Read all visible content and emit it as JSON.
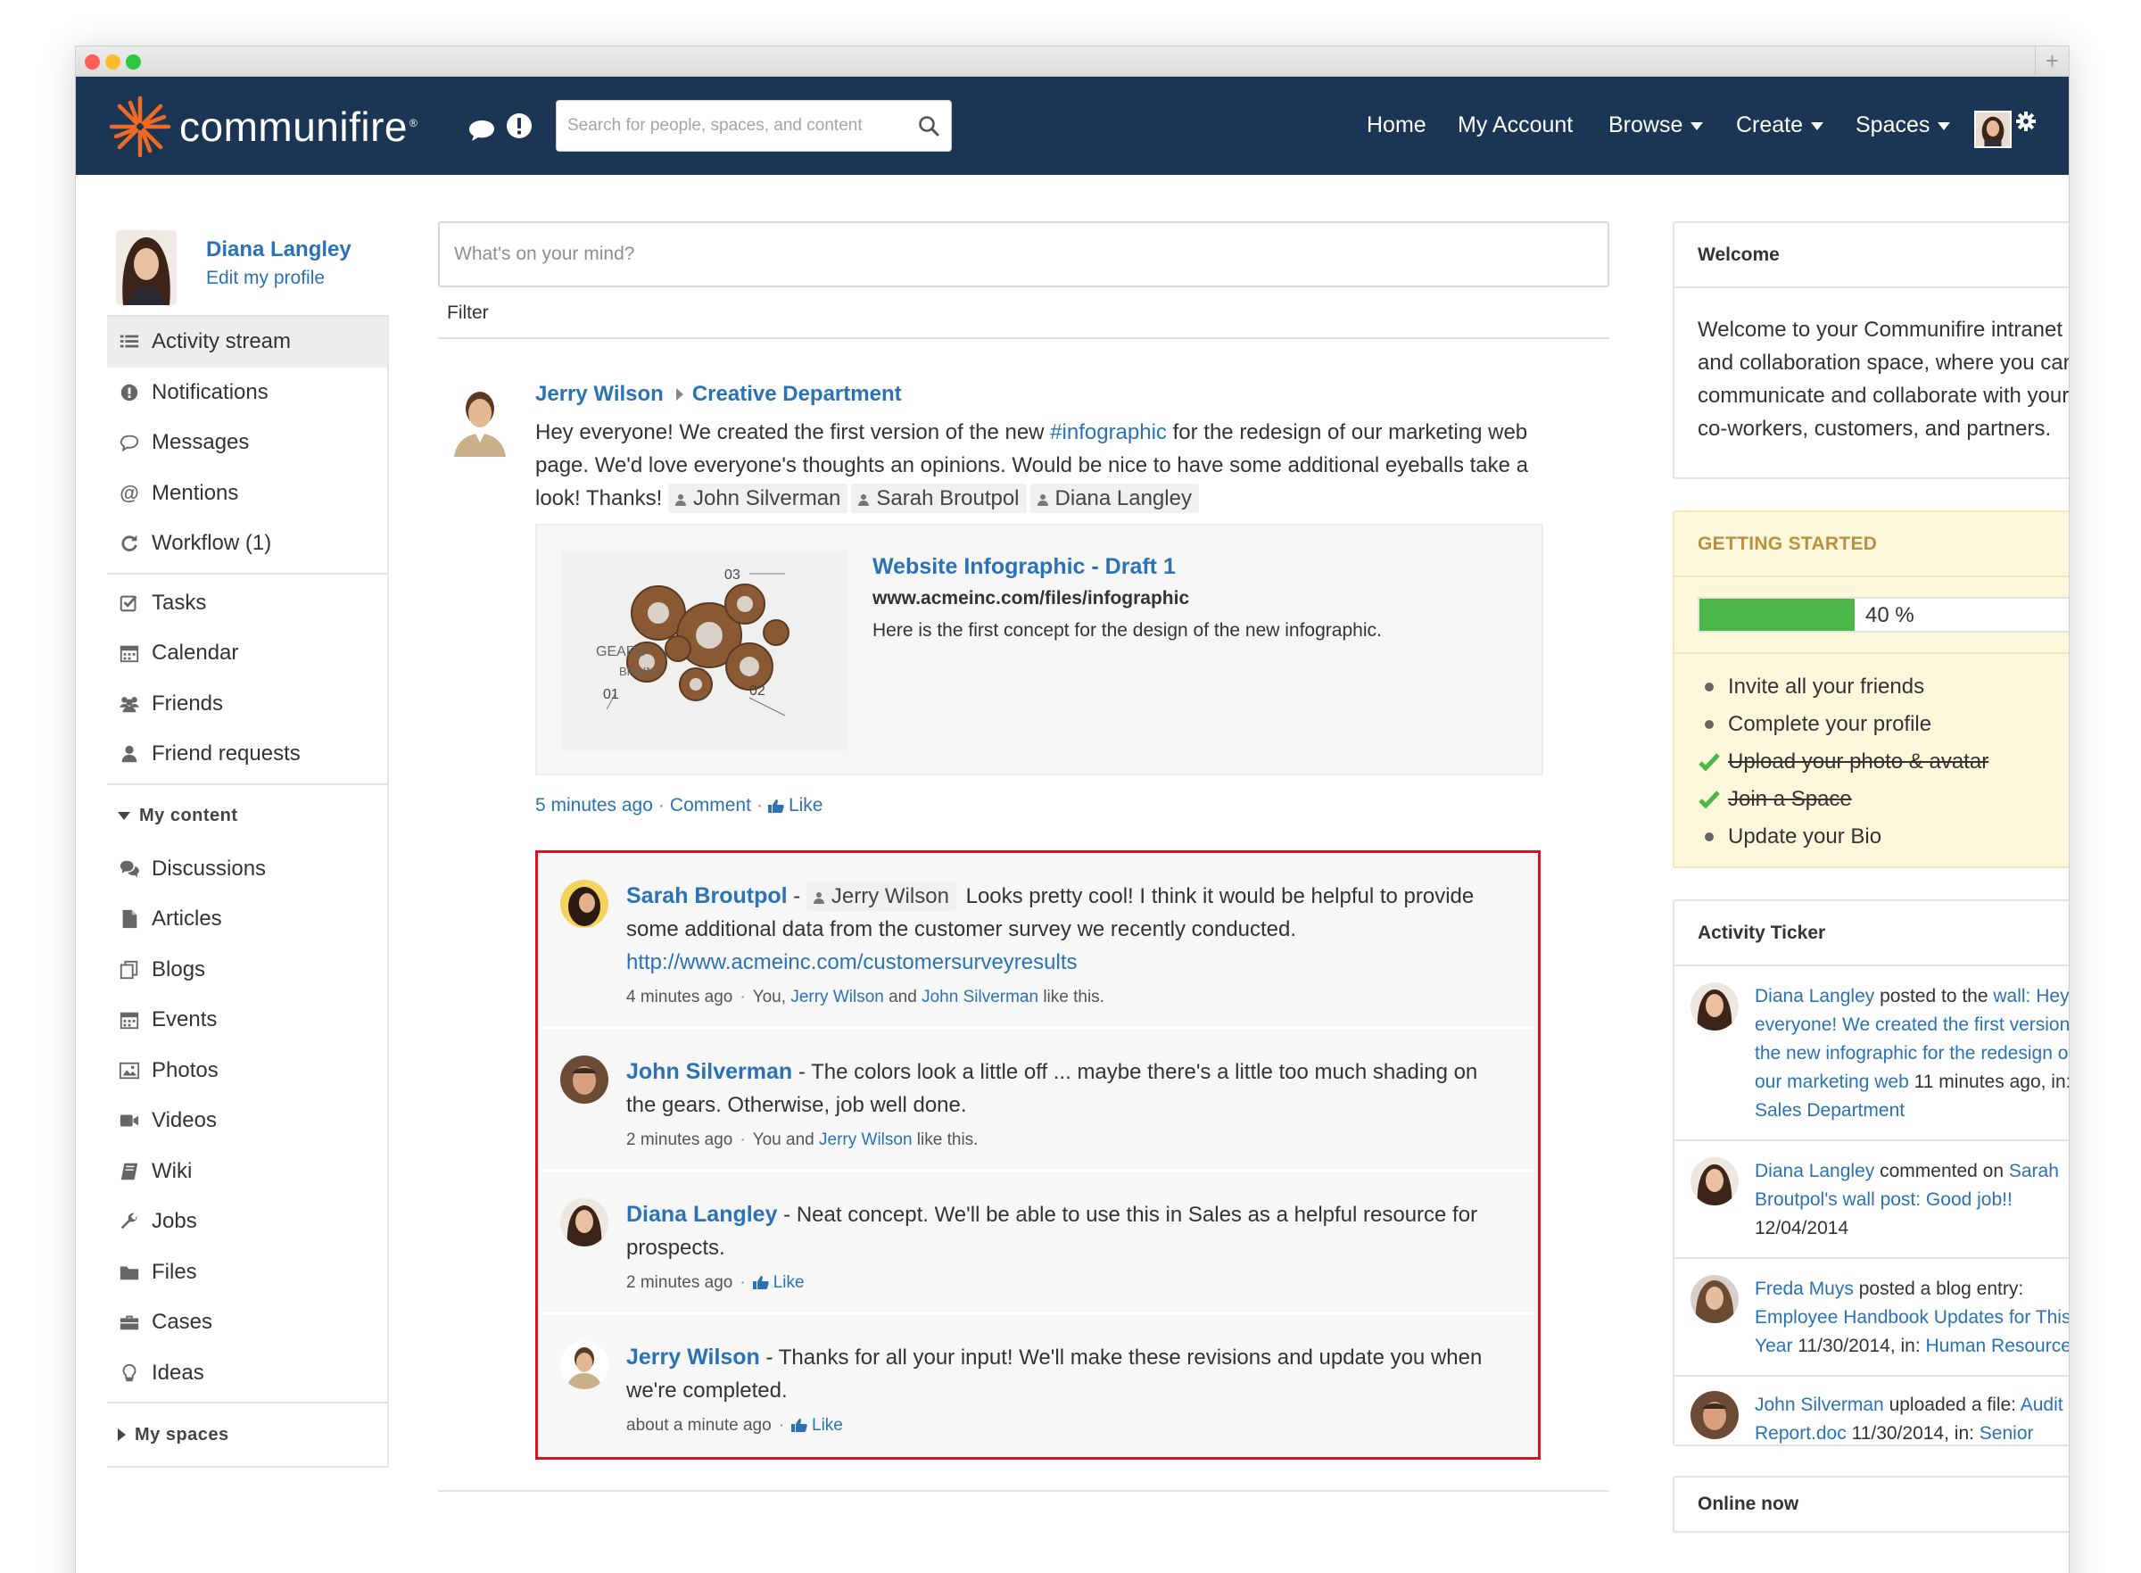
{
  "nav": {
    "brand": "communifire",
    "search_placeholder": "Search for people, spaces, and content",
    "links": [
      "Home",
      "My Account",
      "Browse",
      "Create",
      "Spaces"
    ]
  },
  "profile": {
    "name": "Diana Langley",
    "edit": "Edit my profile"
  },
  "sidebar": {
    "group1": [
      {
        "label": "Activity stream",
        "icon": "list-icon"
      },
      {
        "label": "Notifications",
        "icon": "exclamation-icon"
      },
      {
        "label": "Messages",
        "icon": "speech-bubble-icon"
      },
      {
        "label": "Mentions",
        "icon": "at-icon"
      },
      {
        "label": "Workflow (1)",
        "icon": "refresh-icon"
      }
    ],
    "group2": [
      {
        "label": "Tasks",
        "icon": "checkbox-icon"
      },
      {
        "label": "Calendar",
        "icon": "calendar-icon"
      },
      {
        "label": "Friends",
        "icon": "group-icon"
      },
      {
        "label": "Friend requests",
        "icon": "user-icon"
      }
    ],
    "my_content_label": "My content",
    "group3": [
      {
        "label": "Discussions",
        "icon": "comments-icon"
      },
      {
        "label": "Articles",
        "icon": "document-icon"
      },
      {
        "label": "Blogs",
        "icon": "blog-icon"
      },
      {
        "label": "Events",
        "icon": "calendar-icon"
      },
      {
        "label": "Photos",
        "icon": "picture-icon"
      },
      {
        "label": "Videos",
        "icon": "video-camera-icon"
      },
      {
        "label": "Wiki",
        "icon": "book-icon"
      },
      {
        "label": "Jobs",
        "icon": "wrench-icon"
      },
      {
        "label": "Files",
        "icon": "folder-icon"
      },
      {
        "label": "Cases",
        "icon": "briefcase-icon"
      },
      {
        "label": "Ideas",
        "icon": "lightbulb-icon"
      }
    ],
    "my_spaces_label": "My spaces"
  },
  "composer": {
    "placeholder": "What's on your mind?",
    "filter": "Filter"
  },
  "post": {
    "author": "Jerry Wilson",
    "space": "Creative Department",
    "text_before": "Hey everyone! We created the first version of the new ",
    "hashtag": "#infographic",
    "text_after": " for the redesign of our marketing web page. We'd love everyone's thoughts an opinions. Would be nice to have some additional eyeballs take a look! Thanks!",
    "mentions": [
      "John Silverman",
      "Sarah Broutpol",
      "Diana Langley"
    ],
    "link": {
      "title": "Website Infographic - Draft 1",
      "url": "www.acmeinc.com/files/infographic",
      "description": "Here is the first concept for the design of the new infographic.",
      "image_text": {
        "num_top": "03",
        "gears": "GEARS",
        "brain": "BRAIN",
        "num_left": "01",
        "num_right": "02"
      }
    },
    "time": "5 minutes ago",
    "comment_label": "Comment",
    "like_label": "Like"
  },
  "comments": [
    {
      "author": "Sarah Broutpol",
      "mention": "Jerry Wilson",
      "text": "Looks pretty cool! I think it would be helpful to provide some additional data from the customer survey we recently conducted.",
      "link": "http://www.acmeinc.com/customersurveyresults",
      "time": "4 minutes ago",
      "likes_prefix": "You, ",
      "like_user1": "Jerry Wilson",
      "likes_mid": " and ",
      "like_user2": "John Silverman",
      "likes_suffix": " like this."
    },
    {
      "author": "John Silverman",
      "text": "The colors look a little off ... maybe there's a little too much shading on the gears. Otherwise, job well done.",
      "time": "2 minutes ago",
      "likes_prefix": "You and ",
      "like_user1": "Jerry Wilson",
      "likes_suffix": " like this."
    },
    {
      "author": "Diana Langley",
      "text": "Neat concept. We'll be able to use this in Sales as a helpful resource for prospects.",
      "time": "2 minutes ago",
      "like_label": "Like"
    },
    {
      "author": "Jerry Wilson",
      "text": "Thanks for all your input! We'll make these revisions and update you when we're completed.",
      "time": "about a minute ago",
      "like_label": "Like"
    }
  ],
  "welcome": {
    "title": "Welcome",
    "text": "Welcome to your Communifire intranet and collaboration space, where you can communicate and collaborate with your co-workers, customers, and partners."
  },
  "getting_started": {
    "title": "GETTING STARTED",
    "progress": 0.4,
    "progress_label": "40 %",
    "items": [
      {
        "label": "Invite all your friends",
        "done": false
      },
      {
        "label": "Complete your profile",
        "done": false
      },
      {
        "label": "Upload your photo & avatar",
        "done": true
      },
      {
        "label": "Join a Space",
        "done": true
      },
      {
        "label": "Update your Bio",
        "done": false
      }
    ]
  },
  "ticker": {
    "title": "Activity Ticker",
    "items": [
      {
        "a": "Diana Langley",
        "b": " posted to the ",
        "c": "wall: Hey everyone! We created the first version of the new infographic for the redesign of our marketing web",
        "d": " 11 minutes ago, in: ",
        "e": "Sales Department"
      },
      {
        "a": "Diana Langley",
        "b": " commented on ",
        "c": "Sarah Broutpol's wall post: Good job!!",
        "d": " 12/04/2014",
        "e": ""
      },
      {
        "a": "Freda Muys",
        "b": " posted a blog entry: ",
        "c": "Employee Handbook Updates for This Year",
        "d": " 11/30/2014, in: ",
        "e": "Human Resources"
      },
      {
        "a": "John Silverman",
        "b": " uploaded a file: ",
        "c": "Audit Report.doc",
        "d": " 11/30/2014, in: ",
        "e": "Senior"
      }
    ]
  },
  "online_now": {
    "title": "Online now"
  },
  "colors": {
    "nav_bg": "#1b3655",
    "link": "#2a72b5",
    "highlight_border": "#d9141e",
    "progress": "#4cb748"
  }
}
